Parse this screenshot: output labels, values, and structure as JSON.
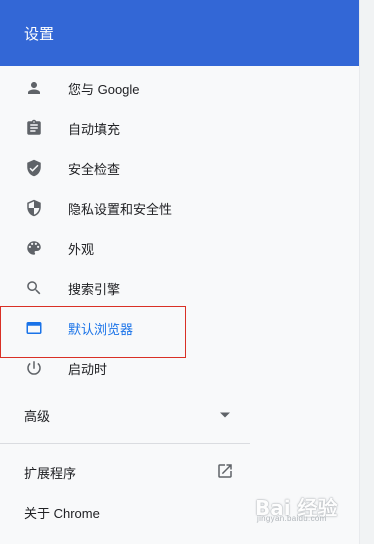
{
  "header": {
    "title": "设置"
  },
  "menu": {
    "items": [
      {
        "label": "您与 Google",
        "icon": "person-icon"
      },
      {
        "label": "自动填充",
        "icon": "clipboard-icon"
      },
      {
        "label": "安全检查",
        "icon": "shield-check-icon"
      },
      {
        "label": "隐私设置和安全性",
        "icon": "shield-half-icon"
      },
      {
        "label": "外观",
        "icon": "palette-icon"
      },
      {
        "label": "搜索引擎",
        "icon": "search-icon"
      },
      {
        "label": "默认浏览器",
        "icon": "browser-window-icon",
        "active": true
      },
      {
        "label": "启动时",
        "icon": "power-icon"
      }
    ]
  },
  "advanced": {
    "label": "高级"
  },
  "extensions": {
    "label": "扩展程序",
    "icon": "open-in-new-icon"
  },
  "about": {
    "label": "关于 Chrome"
  },
  "watermark": {
    "logo": "Bai 经验",
    "url": "jingyan.baidu.com"
  },
  "colors": {
    "header": "#3367d6",
    "active": "#1a73e8",
    "highlight_border": "#d93025",
    "background": "#f8f9fa"
  }
}
